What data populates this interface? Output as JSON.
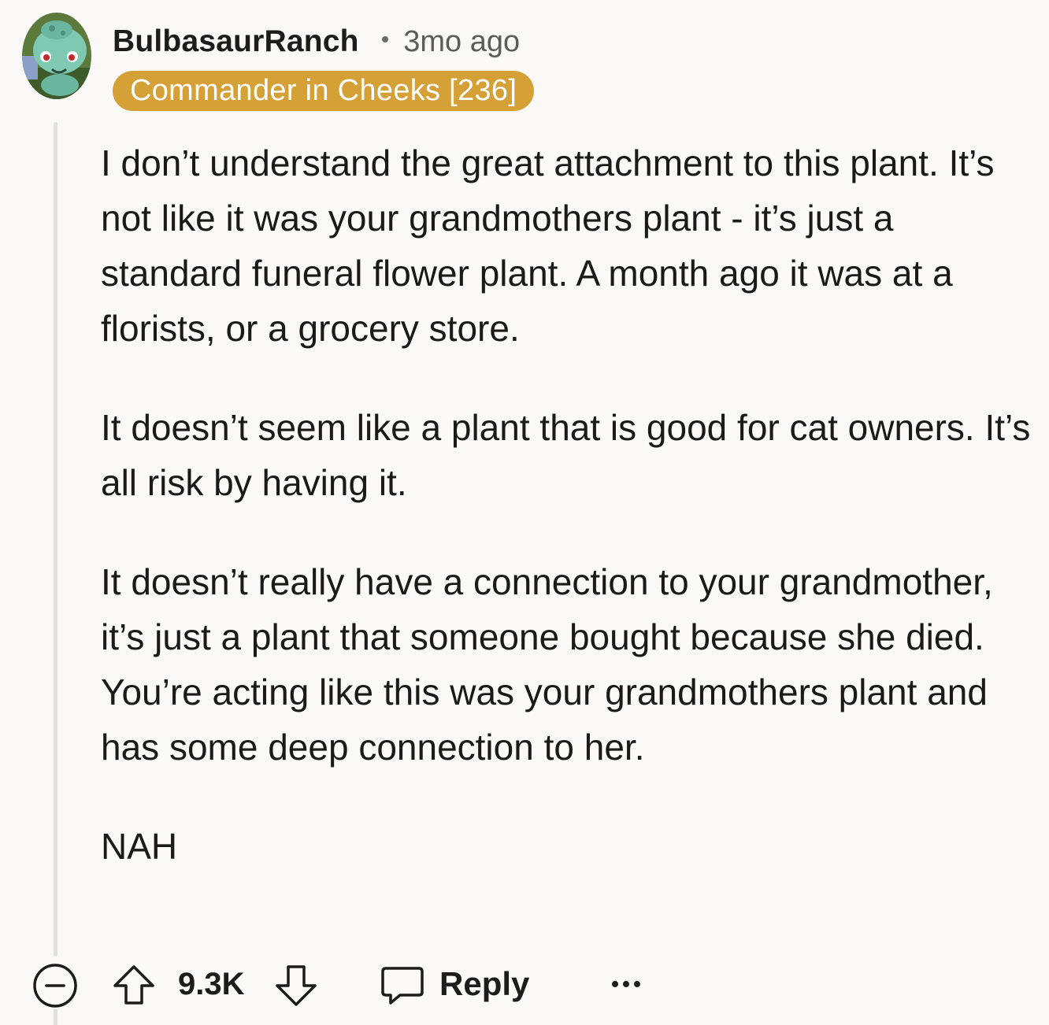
{
  "comment": {
    "username": "BulbasaurRanch",
    "separator": "•",
    "timestamp": "3mo ago",
    "flair": "Commander in Cheeks [236]",
    "paragraphs": [
      "I don’t understand the great attachment to this plant. It’s not like it was your grandmothers plant - it’s just a standard funeral flower plant. A month ago it was at a florists, or a grocery store.",
      "It doesn’t seem like a plant that is good for cat owners. It’s all risk by having it.",
      "It doesn’t really have a connection to your grandmother, it’s just a plant that someone bought because she died. You’re acting like this was your grandmothers plant and has some deep connection to her.",
      "NAH"
    ]
  },
  "actions": {
    "collapse_icon": "minus-circle-icon",
    "upvote_icon": "arrow-up-icon",
    "vote_count": "9.3K",
    "downvote_icon": "arrow-down-icon",
    "reply_icon": "speech-bubble-icon",
    "reply_label": "Reply",
    "more_icon": "ellipsis-icon"
  },
  "colors": {
    "flair_bg": "#d5a036",
    "background": "#faf9f7",
    "thread_line": "#e3e1dd"
  }
}
